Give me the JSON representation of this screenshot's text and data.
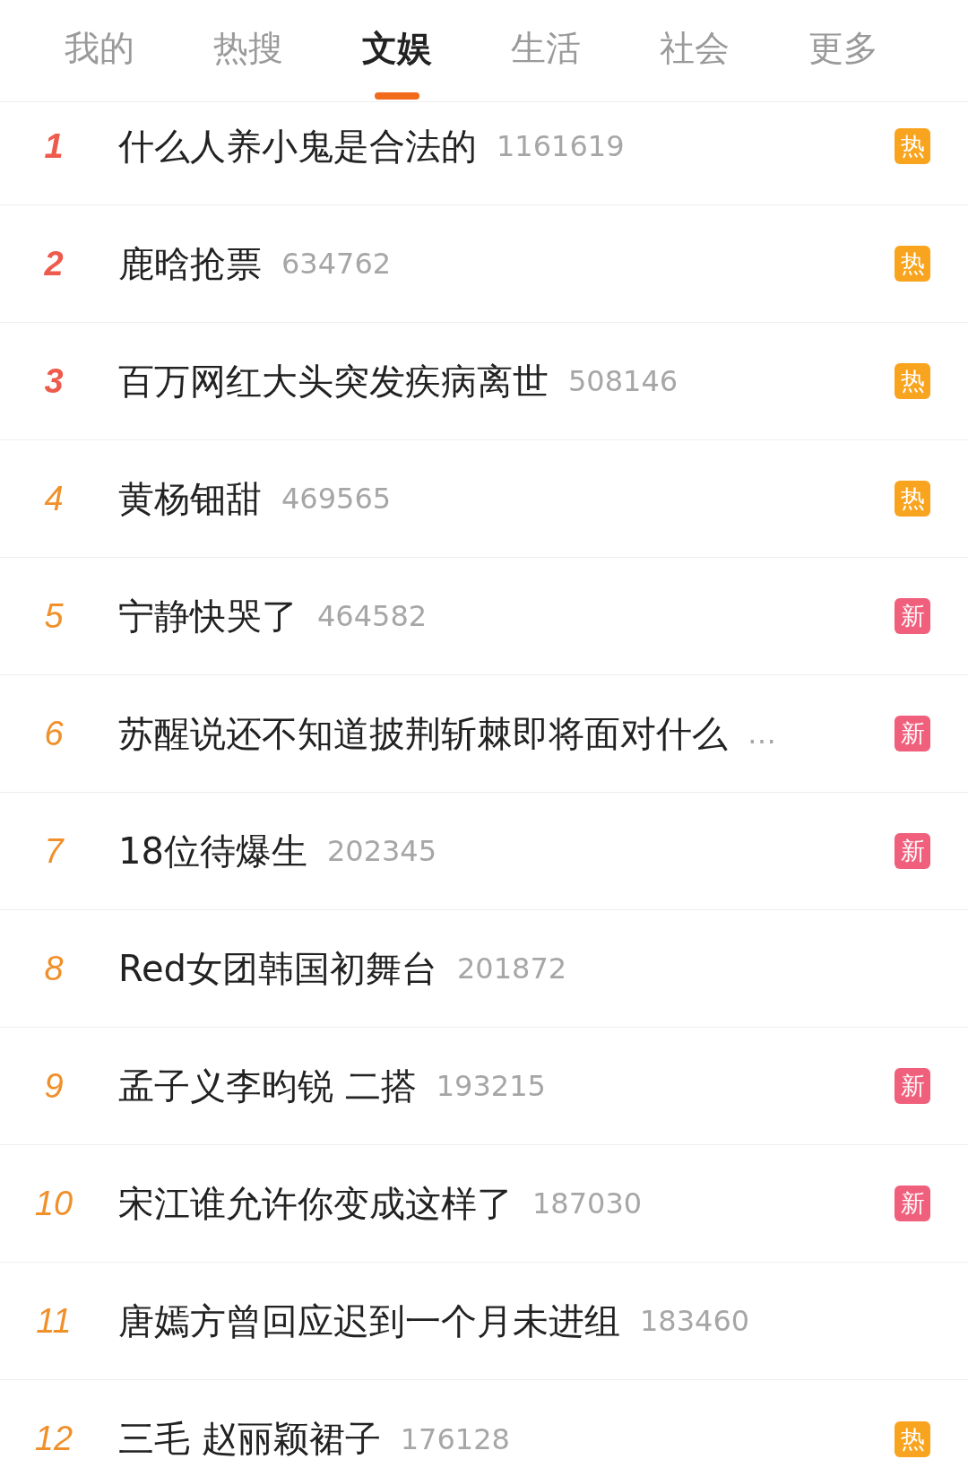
{
  "tabs": [
    {
      "label": "我的",
      "selected": false
    },
    {
      "label": "热搜",
      "selected": false
    },
    {
      "label": "文娱",
      "selected": true
    },
    {
      "label": "生活",
      "selected": false
    },
    {
      "label": "社会",
      "selected": false
    },
    {
      "label": "更多",
      "selected": false
    }
  ],
  "items": [
    {
      "rank": "1",
      "top": true,
      "title": "什么人养小鬼是合法的",
      "count": "1161619",
      "badge": {
        "kind": "hot",
        "label": "热"
      }
    },
    {
      "rank": "2",
      "top": true,
      "title": "鹿晗抢票",
      "count": "634762",
      "badge": {
        "kind": "hot",
        "label": "热"
      }
    },
    {
      "rank": "3",
      "top": true,
      "title": "百万网红大头突发疾病离世",
      "count": "508146",
      "badge": {
        "kind": "hot",
        "label": "热"
      }
    },
    {
      "rank": "4",
      "top": false,
      "title": "黄杨钿甜",
      "count": "469565",
      "badge": {
        "kind": "hot",
        "label": "热"
      }
    },
    {
      "rank": "5",
      "top": false,
      "title": "宁静快哭了",
      "count": "464582",
      "badge": {
        "kind": "new",
        "label": "新"
      }
    },
    {
      "rank": "6",
      "top": false,
      "title": "苏醒说还不知道披荆斩棘即将面对什么",
      "count": "…",
      "badge": {
        "kind": "new",
        "label": "新"
      }
    },
    {
      "rank": "7",
      "top": false,
      "title": "18位待爆生",
      "count": "202345",
      "badge": {
        "kind": "new",
        "label": "新"
      }
    },
    {
      "rank": "8",
      "top": false,
      "title": "Red女团韩国初舞台",
      "count": "201872"
    },
    {
      "rank": "9",
      "top": false,
      "title": "孟子义李昀锐 二搭",
      "count": "193215",
      "badge": {
        "kind": "new",
        "label": "新"
      }
    },
    {
      "rank": "10",
      "top": false,
      "title": "宋江谁允许你变成这样了",
      "count": "187030",
      "badge": {
        "kind": "new",
        "label": "新"
      }
    },
    {
      "rank": "11",
      "top": false,
      "title": "唐嫣方曾回应迟到一个月未进组",
      "count": "183460"
    },
    {
      "rank": "12",
      "top": false,
      "title": "三毛 赵丽颖裙子",
      "count": "176128",
      "badge": {
        "kind": "hot",
        "label": "热"
      }
    }
  ]
}
